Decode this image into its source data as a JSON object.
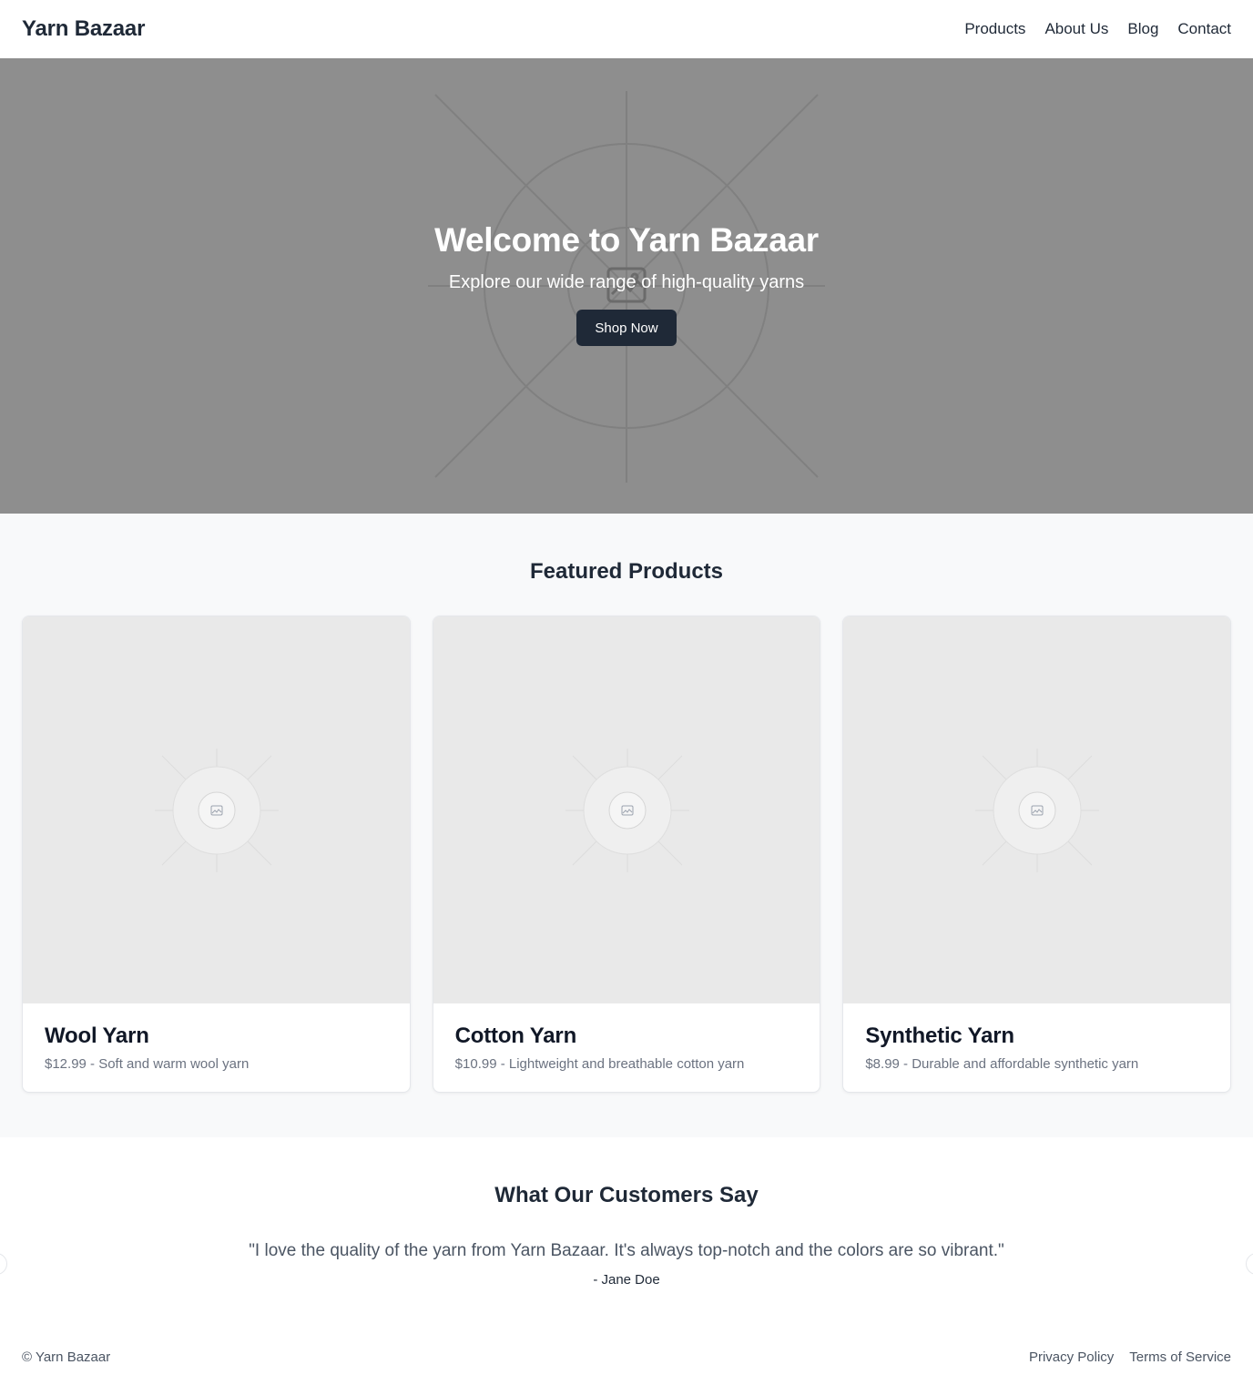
{
  "header": {
    "brand": "Yarn Bazaar",
    "nav": [
      "Products",
      "About Us",
      "Blog",
      "Contact"
    ]
  },
  "hero": {
    "title": "Welcome to Yarn Bazaar",
    "subtitle": "Explore our wide range of high-quality yarns",
    "cta_label": "Shop Now",
    "background_color": "#8e8e8e",
    "image_icon": "image-placeholder-icon"
  },
  "featured": {
    "title": "Featured Products",
    "products": [
      {
        "name": "Wool Yarn",
        "meta": "$12.99 - Soft and warm wool yarn"
      },
      {
        "name": "Cotton Yarn",
        "meta": "$10.99 - Lightweight and breathable cotton yarn"
      },
      {
        "name": "Synthetic Yarn",
        "meta": "$8.99 - Durable and affordable synthetic yarn"
      }
    ]
  },
  "testimonials": {
    "title": "What Our Customers Say",
    "quote": "\"I love the quality of the yarn from Yarn Bazaar. It's always top-notch and the colors are so vibrant.\"",
    "author": "- Jane Doe"
  },
  "footer": {
    "copyright": "© Yarn Bazaar",
    "links": [
      "Privacy Policy",
      "Terms of Service"
    ]
  },
  "colors": {
    "primary": "#1f2937",
    "muted_text": "#6b7280",
    "section_bg": "#f8f9fa",
    "placeholder_bg": "#e9e9e9"
  }
}
